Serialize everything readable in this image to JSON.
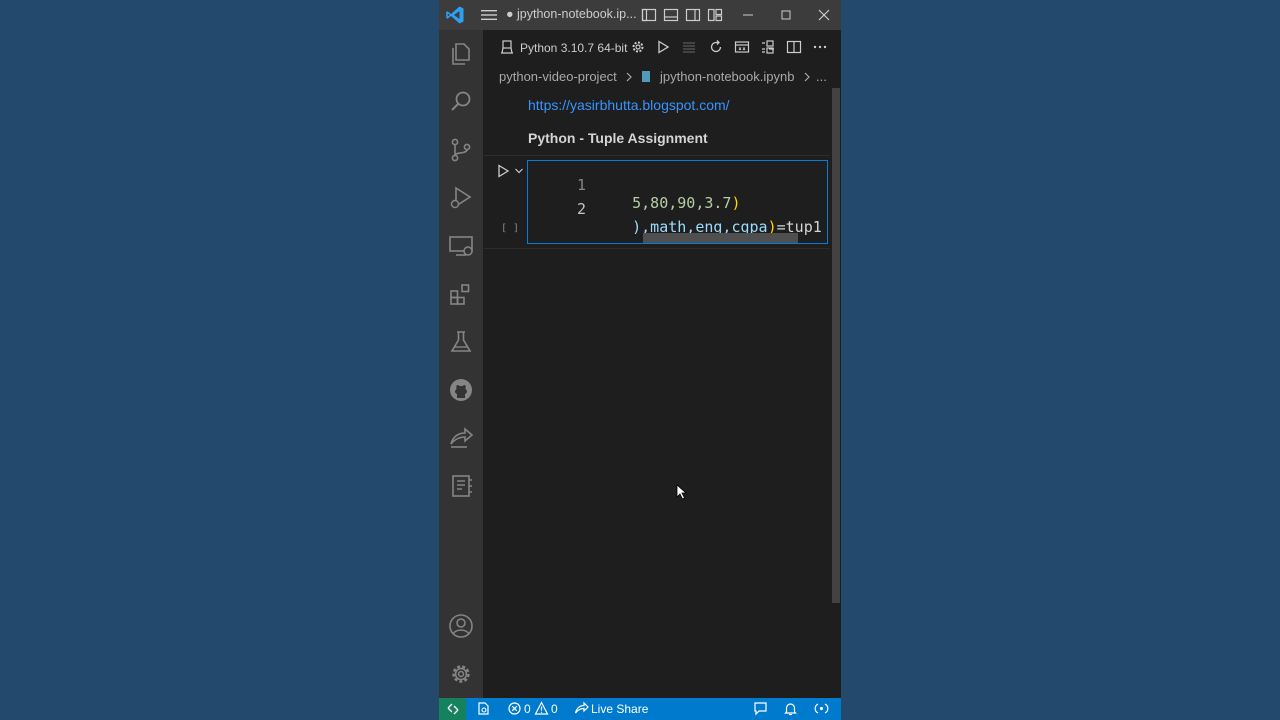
{
  "window": {
    "title": "● jpython-notebook.ip...",
    "controls": [
      "minimize-icon",
      "maximize-icon",
      "close-icon"
    ]
  },
  "activity_bar": {
    "items": [
      "explorer-icon",
      "search-icon",
      "source-control-icon",
      "run-debug-icon",
      "remote-explorer-icon",
      "extensions-icon",
      "testing-icon",
      "github-icon",
      "live-share-icon",
      "notebook-icon"
    ],
    "bottom": [
      "accounts-icon",
      "settings-gear-icon"
    ]
  },
  "editor_toolbar": {
    "kernel": "Python 3.10.7 64-bit"
  },
  "breadcrumb": {
    "folder": "python-video-project",
    "file": "jpython-notebook.ipynb",
    "more": "..."
  },
  "notebook": {
    "markdown_link": "https://yasirbhutta.blogspot.com/",
    "markdown_heading": "Python - Tuple Assignment",
    "code_cell": {
      "execution_count": "[ ]",
      "lines": [
        {
          "number": "1",
          "segments": [
            {
              "text": "5,80,90,3.7",
              "color": "#b5cea8"
            },
            {
              "text": ")",
              "color": "#ffd700"
            }
          ]
        },
        {
          "number": "2",
          "segments": [
            {
              "text": "),math,eng,cgpa",
              "color": "#9cdcfe"
            },
            {
              "text": ")",
              "color": "#ffd700"
            },
            {
              "text": "=tup1",
              "color": "#d4d4d4"
            }
          ]
        }
      ]
    }
  },
  "status_bar": {
    "errors": "0",
    "warnings": "0",
    "live_share": "Live Share"
  },
  "colors": {
    "accent": "#007acc",
    "focus_border": "#007fd4",
    "link": "#3794ff",
    "remote": "#16825d"
  }
}
